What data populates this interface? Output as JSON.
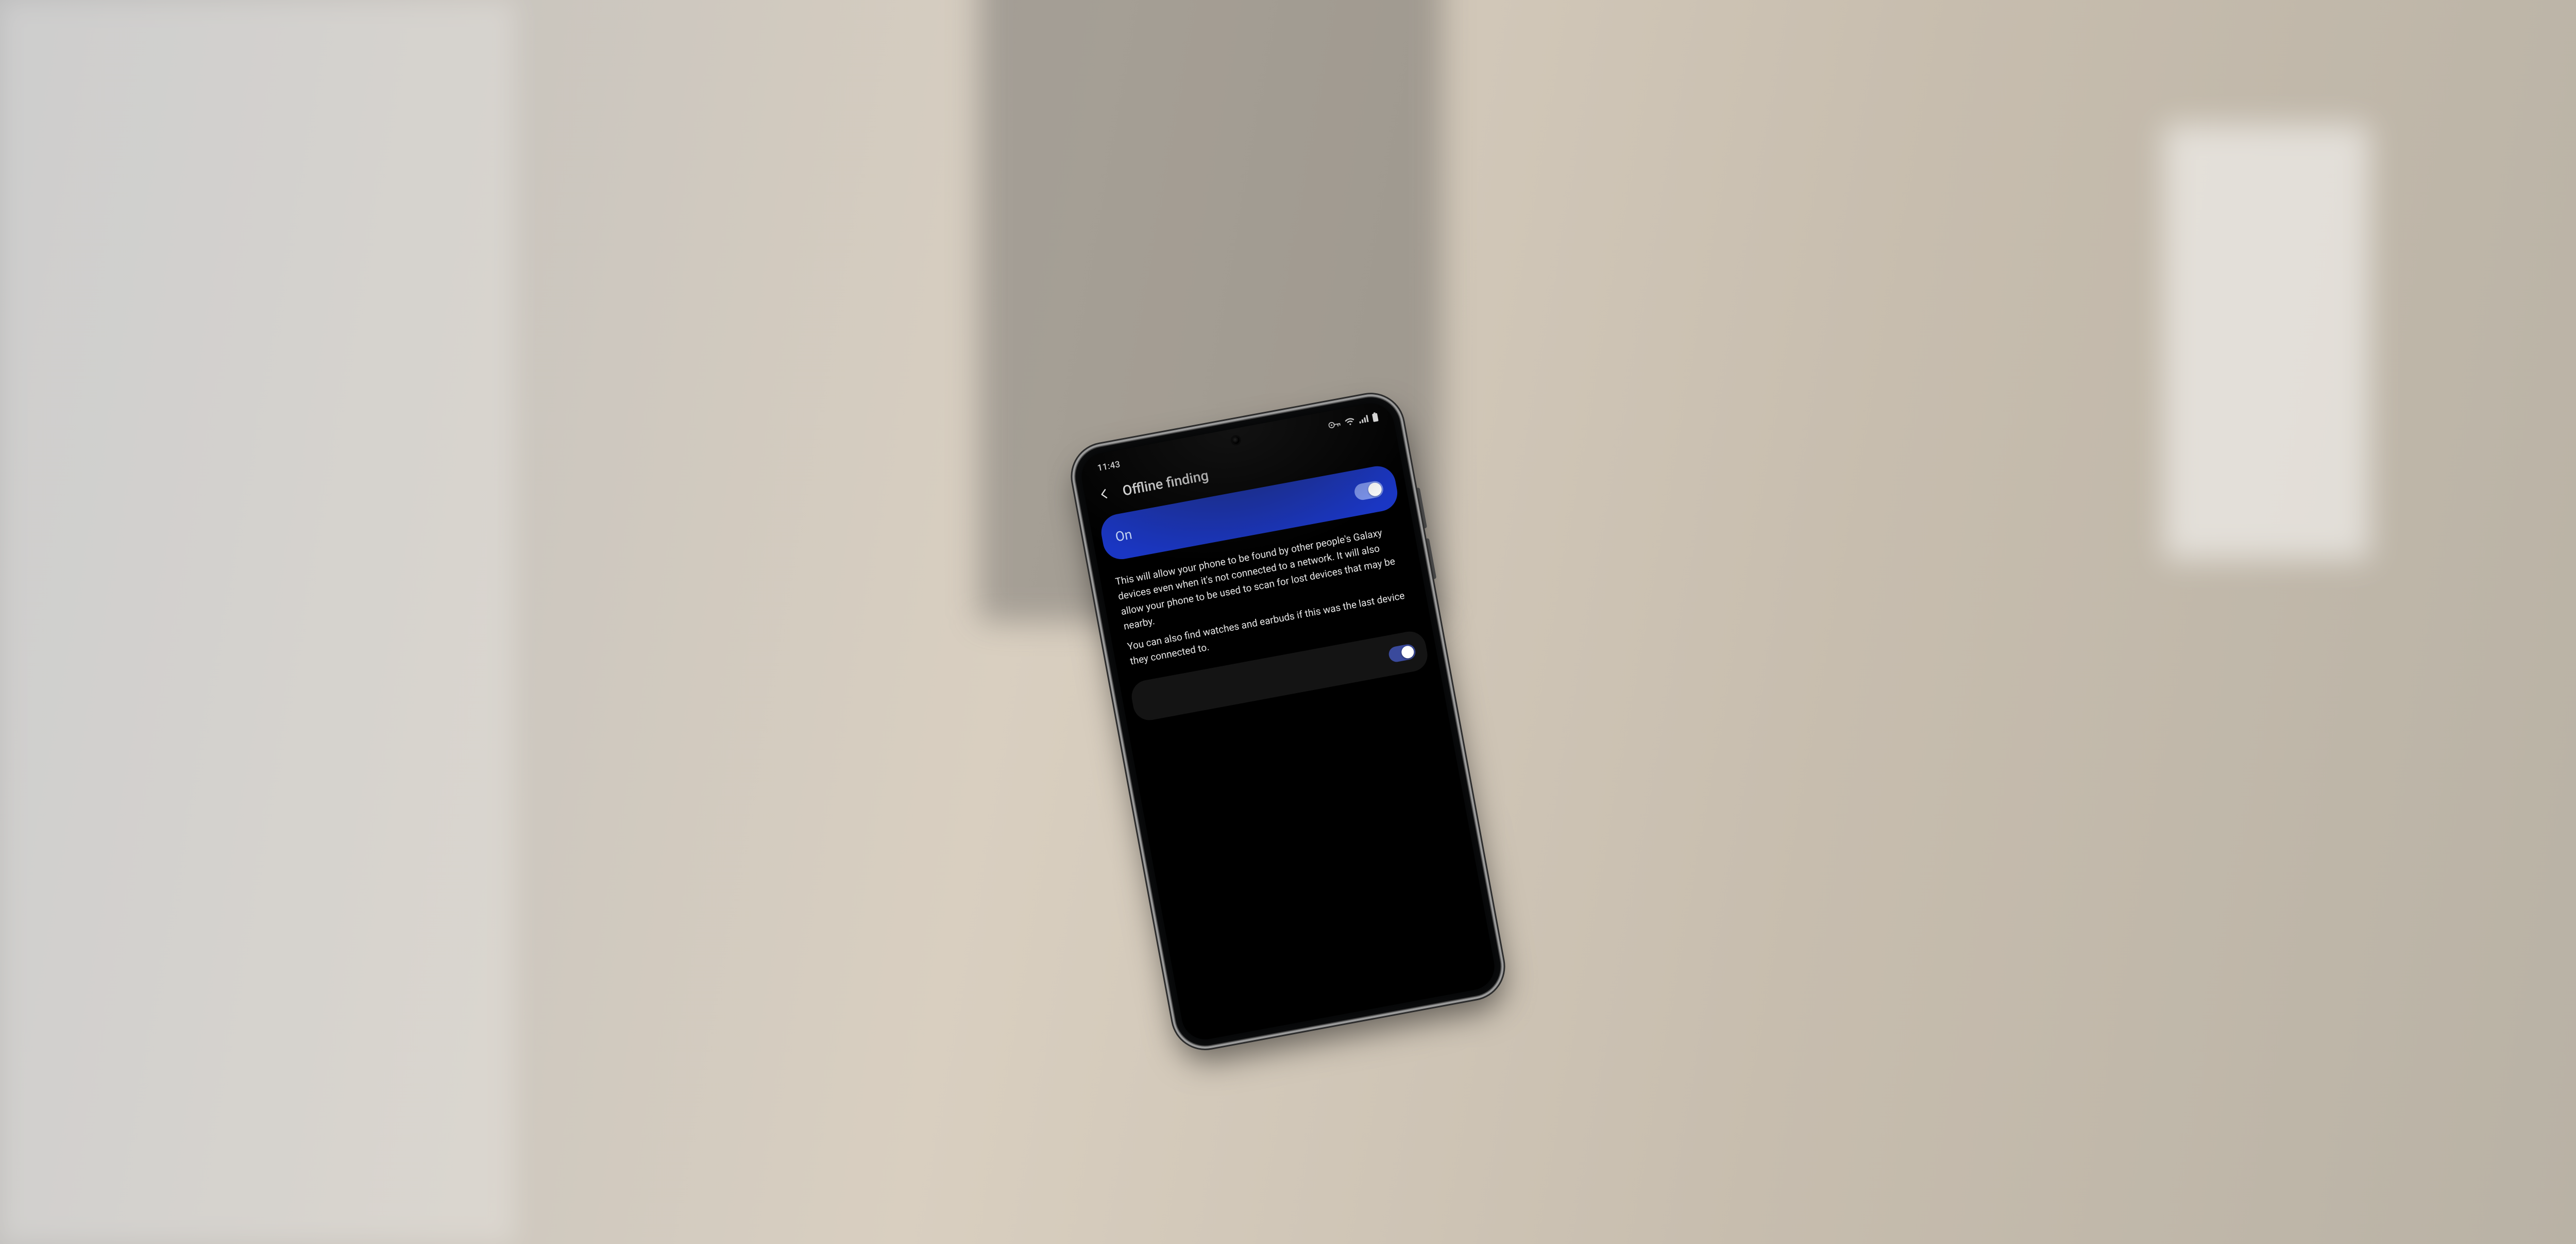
{
  "status": {
    "time": "11:43"
  },
  "header": {
    "title": "Offline finding"
  },
  "masterToggle": {
    "state_label": "On",
    "enabled": true
  },
  "description": {
    "p1": "This will allow your phone to be found by other people's Galaxy devices even when it's not connected to a network. It will also allow your phone to be used to scan for lost devices that may be nearby.",
    "p2": "You can also find watches and earbuds if this was the last device they connected to."
  },
  "secondaryToggle": {
    "enabled": true
  },
  "colors": {
    "accent": "#1a36c4",
    "accent_light": "#7e96f0"
  }
}
